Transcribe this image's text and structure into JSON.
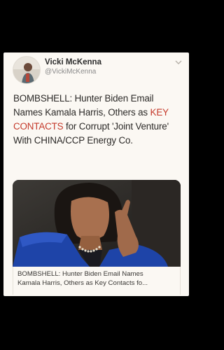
{
  "tweet": {
    "author_name": "Vicki McKenna",
    "author_handle": "@VickiMcKenna",
    "text_segments": [
      {
        "text": "BOMBSHELL: Hunter Biden Email Names Kamala Harris, Others as ",
        "highlight": false
      },
      {
        "text": "KEY CONTACTS",
        "highlight": true
      },
      {
        "text": " for Corrupt 'Joint Venture' With CHINA/CCP Energy Co.",
        "highlight": false
      }
    ],
    "link_card": {
      "title_line_1": "BOMBSHELL: Hunter Biden Email Names",
      "title_line_2": "Kamala Harris, Others as Key Contacts fo..."
    }
  },
  "icons": {
    "avatar": "profile-photo",
    "more": "chevron-down-icon",
    "media": "article-photo"
  },
  "colors": {
    "background": "#000000",
    "card": "#fbf8f3",
    "highlight": "#c4392a",
    "text": "#2c2a28"
  }
}
